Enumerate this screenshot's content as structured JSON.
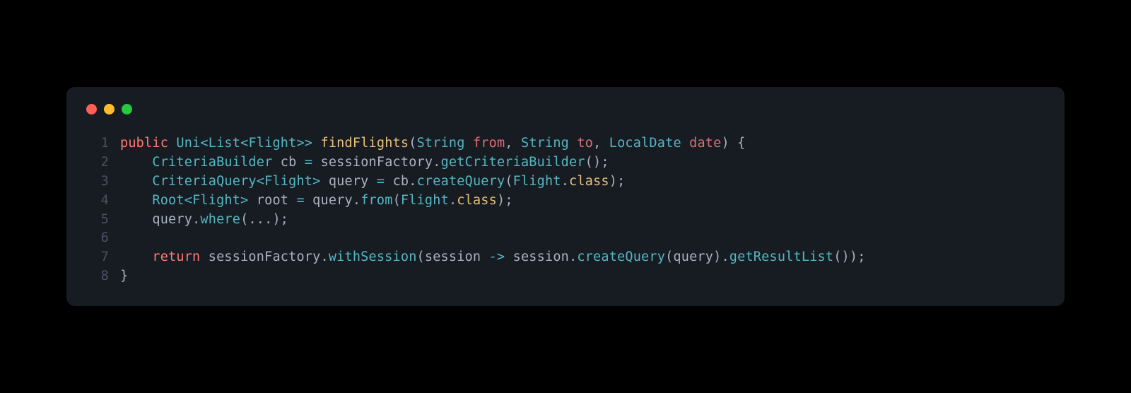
{
  "code": {
    "lines": [
      {
        "n": "1",
        "tokens": [
          {
            "t": "public",
            "c": "tok-kw"
          },
          {
            "t": " ",
            "c": "tok-punc"
          },
          {
            "t": "Uni",
            "c": "tok-type"
          },
          {
            "t": "<",
            "c": "tok-op"
          },
          {
            "t": "List",
            "c": "tok-type"
          },
          {
            "t": "<",
            "c": "tok-op"
          },
          {
            "t": "Flight",
            "c": "tok-type"
          },
          {
            "t": ">>",
            "c": "tok-op"
          },
          {
            "t": " ",
            "c": "tok-punc"
          },
          {
            "t": "findFlights",
            "c": "tok-fn"
          },
          {
            "t": "(",
            "c": "tok-punc"
          },
          {
            "t": "String",
            "c": "tok-type"
          },
          {
            "t": " ",
            "c": "tok-punc"
          },
          {
            "t": "from",
            "c": "tok-param"
          },
          {
            "t": ", ",
            "c": "tok-punc"
          },
          {
            "t": "String",
            "c": "tok-type"
          },
          {
            "t": " ",
            "c": "tok-punc"
          },
          {
            "t": "to",
            "c": "tok-param"
          },
          {
            "t": ", ",
            "c": "tok-punc"
          },
          {
            "t": "LocalDate",
            "c": "tok-type"
          },
          {
            "t": " ",
            "c": "tok-punc"
          },
          {
            "t": "date",
            "c": "tok-param"
          },
          {
            "t": ") {",
            "c": "tok-punc"
          }
        ]
      },
      {
        "n": "2",
        "tokens": [
          {
            "t": "    ",
            "c": "tok-punc"
          },
          {
            "t": "CriteriaBuilder",
            "c": "tok-type"
          },
          {
            "t": " ",
            "c": "tok-punc"
          },
          {
            "t": "cb",
            "c": "tok-var"
          },
          {
            "t": " ",
            "c": "tok-punc"
          },
          {
            "t": "=",
            "c": "tok-op"
          },
          {
            "t": " ",
            "c": "tok-punc"
          },
          {
            "t": "sessionFactory",
            "c": "tok-var"
          },
          {
            "t": ".",
            "c": "tok-punc"
          },
          {
            "t": "getCriteriaBuilder",
            "c": "tok-call"
          },
          {
            "t": "();",
            "c": "tok-punc"
          }
        ]
      },
      {
        "n": "3",
        "tokens": [
          {
            "t": "    ",
            "c": "tok-punc"
          },
          {
            "t": "CriteriaQuery",
            "c": "tok-type"
          },
          {
            "t": "<",
            "c": "tok-op"
          },
          {
            "t": "Flight",
            "c": "tok-type"
          },
          {
            "t": ">",
            "c": "tok-op"
          },
          {
            "t": " ",
            "c": "tok-punc"
          },
          {
            "t": "query",
            "c": "tok-var"
          },
          {
            "t": " ",
            "c": "tok-punc"
          },
          {
            "t": "=",
            "c": "tok-op"
          },
          {
            "t": " ",
            "c": "tok-punc"
          },
          {
            "t": "cb",
            "c": "tok-var"
          },
          {
            "t": ".",
            "c": "tok-punc"
          },
          {
            "t": "createQuery",
            "c": "tok-call"
          },
          {
            "t": "(",
            "c": "tok-punc"
          },
          {
            "t": "Flight",
            "c": "tok-type"
          },
          {
            "t": ".",
            "c": "tok-punc"
          },
          {
            "t": "class",
            "c": "tok-prop"
          },
          {
            "t": ");",
            "c": "tok-punc"
          }
        ]
      },
      {
        "n": "4",
        "tokens": [
          {
            "t": "    ",
            "c": "tok-punc"
          },
          {
            "t": "Root",
            "c": "tok-type"
          },
          {
            "t": "<",
            "c": "tok-op"
          },
          {
            "t": "Flight",
            "c": "tok-type"
          },
          {
            "t": ">",
            "c": "tok-op"
          },
          {
            "t": " ",
            "c": "tok-punc"
          },
          {
            "t": "root",
            "c": "tok-var"
          },
          {
            "t": " ",
            "c": "tok-punc"
          },
          {
            "t": "=",
            "c": "tok-op"
          },
          {
            "t": " ",
            "c": "tok-punc"
          },
          {
            "t": "query",
            "c": "tok-var"
          },
          {
            "t": ".",
            "c": "tok-punc"
          },
          {
            "t": "from",
            "c": "tok-call"
          },
          {
            "t": "(",
            "c": "tok-punc"
          },
          {
            "t": "Flight",
            "c": "tok-type"
          },
          {
            "t": ".",
            "c": "tok-punc"
          },
          {
            "t": "class",
            "c": "tok-prop"
          },
          {
            "t": ");",
            "c": "tok-punc"
          }
        ]
      },
      {
        "n": "5",
        "tokens": [
          {
            "t": "    ",
            "c": "tok-punc"
          },
          {
            "t": "query",
            "c": "tok-var"
          },
          {
            "t": ".",
            "c": "tok-punc"
          },
          {
            "t": "where",
            "c": "tok-call"
          },
          {
            "t": "(...);",
            "c": "tok-punc"
          }
        ]
      },
      {
        "n": "6",
        "tokens": [
          {
            "t": "",
            "c": "tok-punc"
          }
        ]
      },
      {
        "n": "7",
        "tokens": [
          {
            "t": "    ",
            "c": "tok-punc"
          },
          {
            "t": "return",
            "c": "tok-kw"
          },
          {
            "t": " ",
            "c": "tok-punc"
          },
          {
            "t": "sessionFactory",
            "c": "tok-var"
          },
          {
            "t": ".",
            "c": "tok-punc"
          },
          {
            "t": "withSession",
            "c": "tok-call"
          },
          {
            "t": "(",
            "c": "tok-punc"
          },
          {
            "t": "session",
            "c": "tok-var"
          },
          {
            "t": " ",
            "c": "tok-punc"
          },
          {
            "t": "->",
            "c": "tok-op"
          },
          {
            "t": " ",
            "c": "tok-punc"
          },
          {
            "t": "session",
            "c": "tok-var"
          },
          {
            "t": ".",
            "c": "tok-punc"
          },
          {
            "t": "createQuery",
            "c": "tok-call"
          },
          {
            "t": "(",
            "c": "tok-punc"
          },
          {
            "t": "query",
            "c": "tok-var"
          },
          {
            "t": ").",
            "c": "tok-punc"
          },
          {
            "t": "getResultList",
            "c": "tok-call"
          },
          {
            "t": "());",
            "c": "tok-punc"
          }
        ]
      },
      {
        "n": "8",
        "tokens": [
          {
            "t": "}",
            "c": "tok-punc"
          }
        ]
      }
    ]
  }
}
